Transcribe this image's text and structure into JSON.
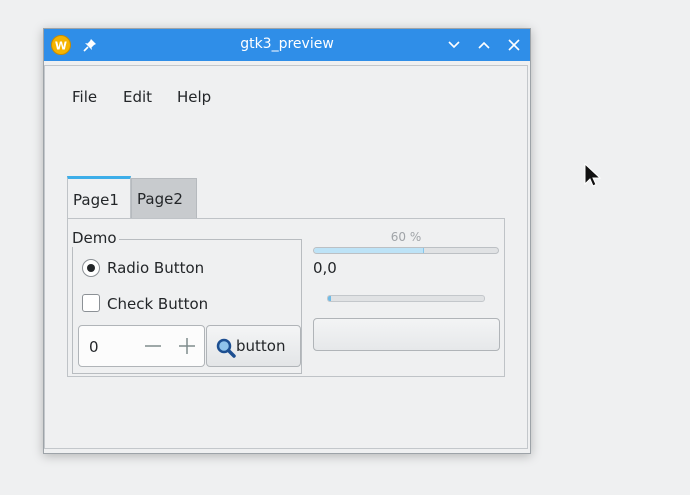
{
  "window": {
    "title": "gtk3_preview",
    "titlebar_color": "#2f8ee8",
    "icons": {
      "app": "app-logo-icon",
      "pin": "pin-icon",
      "minimize": "chevron-down-icon",
      "maximize": "chevron-up-icon",
      "close": "close-icon"
    }
  },
  "menubar": {
    "items": [
      "File",
      "Edit",
      "Help"
    ]
  },
  "tabs": [
    {
      "label": "Page1",
      "active": true
    },
    {
      "label": "Page2",
      "active": false
    }
  ],
  "demo": {
    "frame_label": "Demo",
    "radio": {
      "label": "Radio Button",
      "checked": true
    },
    "check": {
      "label": "Check Button",
      "checked": false
    },
    "spin": {
      "value": "0"
    },
    "search_button": {
      "label": "button",
      "icon": "search-icon"
    }
  },
  "right_panel": {
    "progress_text": "60 %",
    "progress_value": 0.6,
    "coords": "0,0",
    "progress2_value": 0.02,
    "accent": "#3daee9"
  }
}
